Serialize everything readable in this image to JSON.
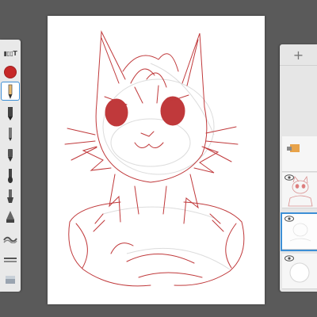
{
  "toolbar": {
    "tools": [
      {
        "id": "brush-set",
        "label": "▮▯▯T"
      },
      {
        "id": "color"
      },
      {
        "id": "pencil"
      },
      {
        "id": "marker"
      },
      {
        "id": "ballpoint"
      },
      {
        "id": "airbrush"
      },
      {
        "id": "paintbrush"
      },
      {
        "id": "smudge"
      },
      {
        "id": "fill"
      },
      {
        "id": "textures-1"
      },
      {
        "id": "textures-2"
      },
      {
        "id": "eraser"
      }
    ],
    "active_tool": "pencil",
    "current_color": "#c62828"
  },
  "layers_panel": {
    "add_glyph": "+",
    "layers": [
      {
        "id": "layer-1",
        "has_eye": false,
        "selected": false
      },
      {
        "id": "layer-2",
        "has_eye": true,
        "selected": false
      },
      {
        "id": "layer-3",
        "has_eye": true,
        "selected": true
      },
      {
        "id": "background",
        "has_eye": true,
        "selected": false
      }
    ]
  },
  "colors": {
    "stroke_red": "#c0393b",
    "sketch_gray": "#d9d9d9",
    "selection_blue": "#3d8fd6"
  }
}
